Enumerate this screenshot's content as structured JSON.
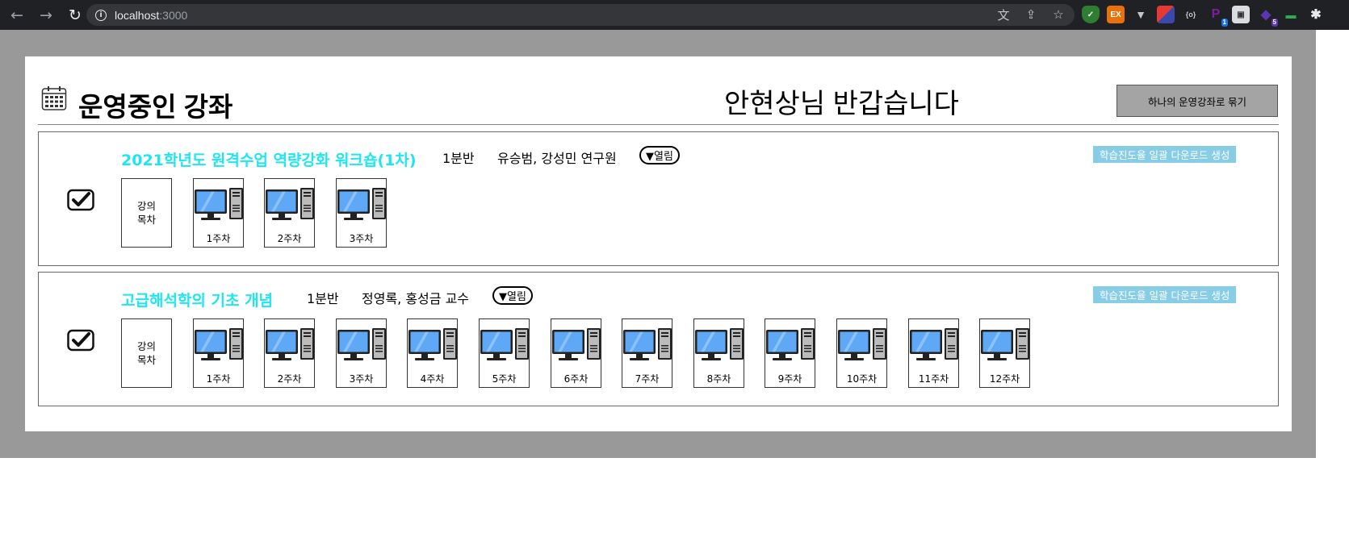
{
  "browser": {
    "url_host": "localhost",
    "url_port": ":3000"
  },
  "header": {
    "title": "운영중인 강좌",
    "greeting": "안현상님 반갑습니다",
    "merge_button": "하나의 운영강좌로 묶기"
  },
  "courses": [
    {
      "title": "2021학년도 원격수업 역량강화 워크숍(1차)",
      "section": "1분반",
      "professors": "유승범, 강성민 연구원",
      "toggle": "▼열림",
      "download": "학습진도율 일괄 다운로드 생성",
      "toc": "강의목차",
      "weeks": [
        "1주차",
        "2주차",
        "3주차"
      ]
    },
    {
      "title": "고급해석학의 기초 개념",
      "section": "1분반",
      "professors": "정영록, 홍성금 교수",
      "toggle": "▼열림",
      "download": "학습진도율 일괄 다운로드 생성",
      "toc": "강의목차",
      "weeks": [
        "1주차",
        "2주차",
        "3주차",
        "4주차",
        "5주차",
        "6주차",
        "7주차",
        "8주차",
        "9주차",
        "10주차",
        "11주차",
        "12주차"
      ]
    }
  ],
  "icons": {
    "checkbox": "checkbox-checked-icon",
    "calendar": "calendar-icon",
    "tile": "desktop-computer-icon"
  },
  "colors": {
    "course_title": "#1ee6f0",
    "download_button": "#87cde6",
    "backdrop": "#999999"
  }
}
